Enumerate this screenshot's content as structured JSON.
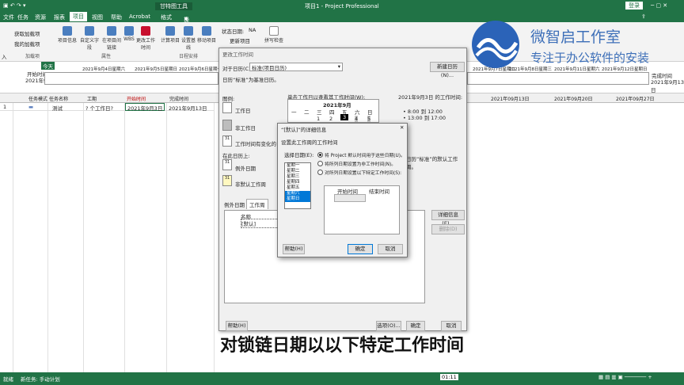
{
  "app": {
    "window_title": "项目1 - Project Professional",
    "context_tool": "甘特图工具",
    "login_label": "登录",
    "ribbon_tabs": [
      "文件",
      "任务",
      "资源",
      "报表",
      "项目",
      "视图",
      "帮助",
      "Acrobat",
      "格式"
    ],
    "search_hint": "操作说明搜索"
  },
  "ribbon": {
    "btn_get_addins": "获取加载项",
    "btn_my_addins": "我的加载项",
    "group_addins": "加载项",
    "btn_project_info": "项目信息",
    "btn_custom_fields": "自定义字段",
    "btn_links": "在项目间链接",
    "btn_wbs": "WBS",
    "btn_change_worktime": "更改工作时间",
    "group_props": "属性",
    "btn_calc": "计算项目",
    "btn_baseline": "设置基线",
    "btn_move": "移动项目",
    "group_schedule": "日程安排",
    "status_date_label": "状态日期:",
    "status_date_value": "NA",
    "btn_update": "更新项目",
    "group_status": "状态",
    "btn_spell": "拼写检查",
    "group_proof": "校对",
    "left_label": "入"
  },
  "timeline": {
    "start_label": "开始时间",
    "start_date": "2021年9月3日",
    "dates": [
      "2021年9月4日星期六",
      "2021年9月5日星期日",
      "2021年9月6日星期一",
      "2021年9月7日星期二",
      "2021年9月8日星期三",
      "2021年9月11日星期六",
      "2021年9月12日星期日"
    ],
    "finish_label": "完成时间",
    "finish_date": "2021年9月13日",
    "lanes": [
      "今天"
    ]
  },
  "table": {
    "headers": [
      "任务模式",
      "任务名称",
      "工期",
      "开始时间",
      "完成时间"
    ],
    "row_num": "1",
    "row": {
      "name": "测试",
      "duration": "? 个工作日?",
      "start": "2021年9月3日",
      "finish": "2021年9月13日"
    },
    "gantt_weeks": [
      "2021年09月13日",
      "2021年09月20日",
      "2021年09月27日"
    ]
  },
  "change_worktime": {
    "title": "更改工作时间",
    "for_calendar_label": "对于日历(C):",
    "calendar_value": "标准(项目日历)",
    "base_note": "日历“标准”为基准日历。",
    "new_cal_btn": "新建日历(N)...",
    "legend_label": "图例:",
    "legend": [
      "工作日",
      "非工作日",
      "工作时间有变化的日期",
      "在此日历上:",
      "例外日期",
      "非默认工作周"
    ],
    "legend_31": "31",
    "click_hint": "单击工作日以查看其工作时间(W):",
    "date_label": "2021年9月3日 的工作时间:",
    "month": "2021年9月",
    "weekdays": [
      "一",
      "二",
      "三",
      "四",
      "五",
      "六",
      "日"
    ],
    "week_dates": [
      "",
      "",
      "1",
      "2",
      "3",
      "4",
      "5"
    ],
    "times": [
      "• 8:00 到 12:00",
      "• 13:00 到 17:00"
    ],
    "basis_note": "基于:",
    "basis_text": "日历“标准”的默认工作周。",
    "tab_exceptions": "例外日期",
    "tab_workweek": "工作周",
    "col_name": "名称",
    "row_default": "[默认]",
    "details_btn": "详细信息(E)...",
    "delete_btn": "删除(D)",
    "help_btn": "帮助(H)",
    "options_btn": "选项(O)...",
    "ok_btn": "确定",
    "cancel_btn": "取消"
  },
  "details": {
    "title": "“[默认]”的详细信息",
    "subtitle": "设置此工作周的工作时间",
    "select_days": "选择日期(E):",
    "days": [
      "星期一",
      "星期二",
      "星期三",
      "星期四",
      "星期五",
      "星期六",
      "星期日"
    ],
    "opt1": "将 Project 默认时间用于这些日期(U)。",
    "opt2": "将所列日期设置为非工作时间(N)。",
    "opt3": "对所列日期设置以下特定工作时间(S):",
    "col_start": "开始时间",
    "col_end": "结束时间",
    "help_btn": "帮助(H)",
    "ok_btn": "确定",
    "cancel_btn": "取消"
  },
  "overlay": {
    "brand_title": "微智启工作室",
    "brand_sub": "专注于办公软件的安装",
    "caption": "对锁链日期以以下特定工作时间"
  },
  "statusbar": {
    "ready": "就绪",
    "new_task": "新任务: 手动计划",
    "time": "01:11"
  },
  "colors": {
    "accent": "#217346",
    "selection": "#0078d7"
  }
}
